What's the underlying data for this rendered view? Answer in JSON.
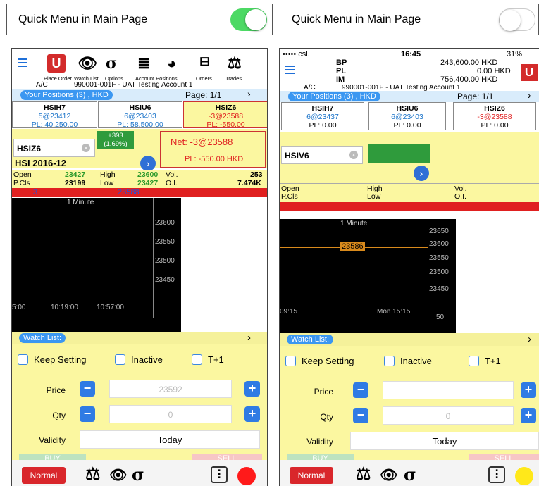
{
  "left_toggle": {
    "label": "Quick Menu in Main Page",
    "state": "on",
    "color": "#4cd964"
  },
  "right_toggle": {
    "label": "Quick Menu in Main Page",
    "state": "off"
  },
  "left": {
    "toolbar": [
      "Place Order",
      "Watch List",
      "Options",
      "Account Positions",
      "Orders",
      "Trades"
    ],
    "ac_label": "A/C",
    "account": "990001-001F - UAT Testing Account 1",
    "positions_label": "Your Positions (3) , HKD",
    "page": "Page: 1/1",
    "positions": [
      {
        "name": "HSIH7",
        "qty": "5@23412",
        "pl": "PL: 40,250.00"
      },
      {
        "name": "HSIU6",
        "qty": "6@23403",
        "pl": "PL: 58,500.00"
      },
      {
        "name": "HSIZ6",
        "qty": "-3@23588",
        "pl": "PL: -550.00"
      }
    ],
    "symbol": "HSIZ6",
    "change": "+393",
    "change_pct": "(1.69%)",
    "net": "Net: -3@23588",
    "contract": "HSI 2016-12",
    "pl_total": "PL: -550.00 HKD",
    "quote": {
      "open_lbl": "Open",
      "open": "23427",
      "high_lbl": "High",
      "high": "23600",
      "vol_lbl": "Vol.",
      "vol": "253",
      "pcls_lbl": "P.Cls",
      "pcls": "23199",
      "low_lbl": "Low",
      "low": "23427",
      "oi_lbl": "O.I.",
      "oi": "7.474K"
    },
    "bid_ask": [
      "3",
      "23588"
    ],
    "chart": {
      "interval": "1 Minute",
      "y_ticks": [
        "23600",
        "23550",
        "23500",
        "23450"
      ],
      "x_ticks": [
        "5:00",
        "10:19:00",
        "10:57:00"
      ]
    },
    "watch_list": "Watch List:",
    "keep": "Keep Setting",
    "inactive": "Inactive",
    "t1": "T+1",
    "price_lbl": "Price",
    "price_val": "23592",
    "qty_lbl": "Qty",
    "qty_val": "0",
    "validity_lbl": "Validity",
    "validity": "Today",
    "buy": "BUY",
    "sell": "SELL",
    "normal": "Normal",
    "dot_color": "#ff1a1a"
  },
  "right": {
    "carrier": "••••• csl.",
    "time": "16:45",
    "battery": "31%",
    "bp_lbl": "BP",
    "bp": "243,600.00 HKD",
    "pl_lbl": "PL",
    "pl": "0.00 HKD",
    "im_lbl": "IM",
    "im": "756,400.00 HKD",
    "ac_label": "A/C",
    "account": "990001-001F - UAT Testing Account 1",
    "positions_label": "Your Positions (3) , HKD",
    "page": "Page: 1/1",
    "positions": [
      {
        "name": "HSIH7",
        "qty": "6@23437",
        "pl": "PL: 0.00"
      },
      {
        "name": "HSIU6",
        "qty": "6@23403",
        "pl": "PL: 0.00"
      },
      {
        "name": "HSIZ6",
        "qty": "-3@23588",
        "pl": "PL: 0.00"
      }
    ],
    "symbol": "HSIV6",
    "quote": {
      "open_lbl": "Open",
      "pcls_lbl": "P.Cls",
      "high_lbl": "High",
      "low_lbl": "Low",
      "vol_lbl": "Vol.",
      "oi_lbl": "O.I."
    },
    "chart": {
      "interval": "1 Minute",
      "price_tag": "23586",
      "y_ticks": [
        "23650",
        "23600",
        "23550",
        "23500",
        "23450"
      ],
      "x_ticks": [
        "09:15",
        "Mon 15:15"
      ],
      "vol_tick": "50"
    },
    "watch_list": "Watch List:",
    "keep": "Keep Setting",
    "inactive": "Inactive",
    "t1": "T+1",
    "price_lbl": "Price",
    "qty_lbl": "Qty",
    "qty_val": "0",
    "validity_lbl": "Validity",
    "validity": "Today",
    "buy": "BUY",
    "sell": "SELL",
    "normal": "Normal",
    "dot_color": "#ffe81a"
  }
}
